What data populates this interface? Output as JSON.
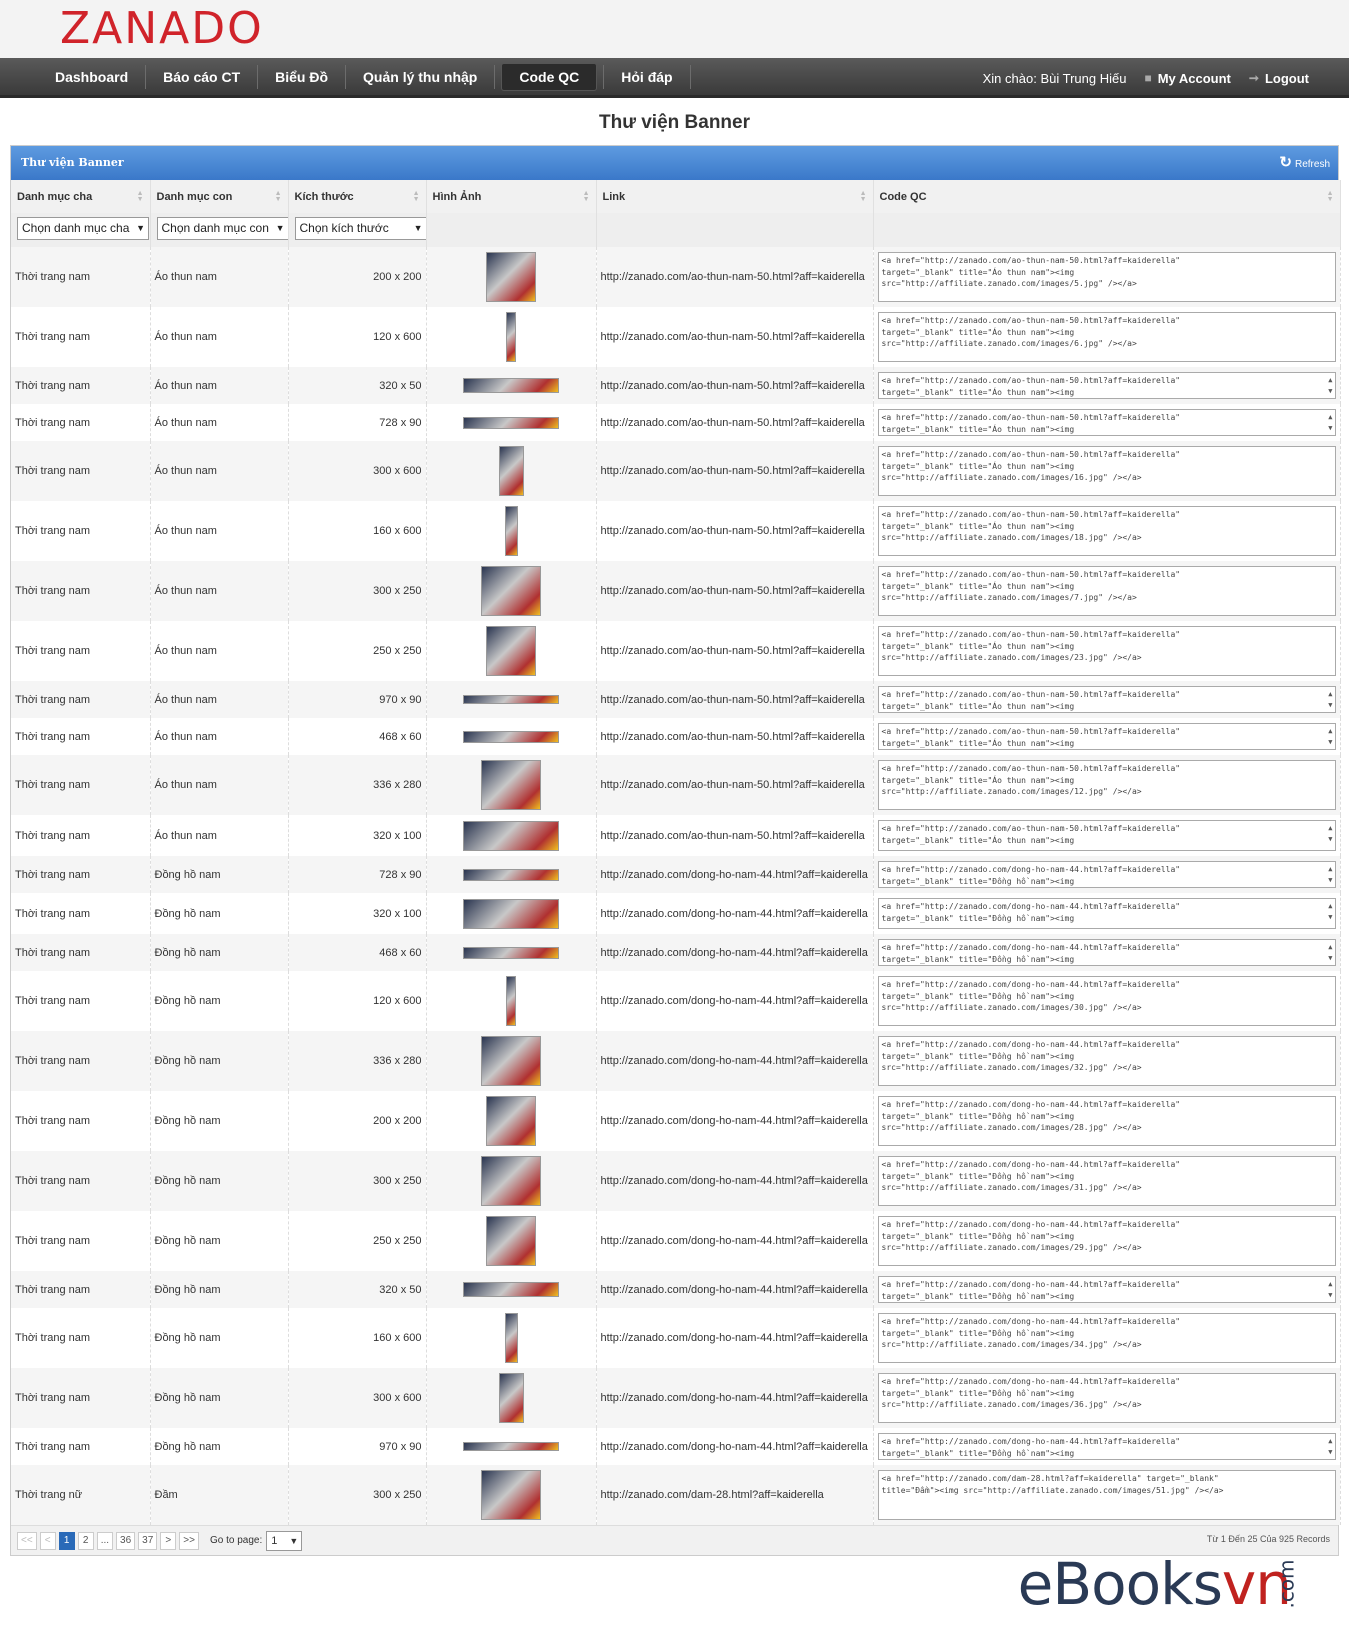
{
  "brand": {
    "logo": "ZANADO"
  },
  "nav": {
    "items": [
      "Dashboard",
      "Báo cáo CT",
      "Biểu Đồ",
      "Quản lý thu nhập",
      "Code QC",
      "Hỏi đáp"
    ],
    "active": "Code QC",
    "greeting": "Xin chào: Bùi Trung Hiếu",
    "account": "My Account",
    "logout": "Logout"
  },
  "page": {
    "title": "Thư viện Banner"
  },
  "panel": {
    "title": "Thư viện Banner",
    "refresh": "Refresh"
  },
  "table": {
    "headers": [
      "Danh mục cha",
      "Danh mục con",
      "Kích thước",
      "Hình Ảnh",
      "Link",
      "Code QC"
    ],
    "filters": [
      "Chọn danh mục cha",
      "Chọn danh mục con",
      "Chọn kích thước"
    ],
    "rows": [
      {
        "parent": "Thời trang nam",
        "child": "Áo thun nam",
        "size": "200 x 200",
        "link": "http://zanado.com/ao-thun-nam-50.html?aff=kaiderella",
        "code": "<a href=\"http://zanado.com/ao-thun-nam-50.html?aff=kaiderella\"\ntarget=\"_blank\" title=\"Áo thun nam\"><img\nsrc=\"http://affiliate.zanado.com/images/5.jpg\" /></a>"
      },
      {
        "parent": "Thời trang nam",
        "child": "Áo thun nam",
        "size": "120 x 600",
        "link": "http://zanado.com/ao-thun-nam-50.html?aff=kaiderella",
        "code": "<a href=\"http://zanado.com/ao-thun-nam-50.html?aff=kaiderella\"\ntarget=\"_blank\" title=\"Áo thun nam\"><img\nsrc=\"http://affiliate.zanado.com/images/6.jpg\" /></a>"
      },
      {
        "parent": "Thời trang nam",
        "child": "Áo thun nam",
        "size": "320 x 50",
        "link": "http://zanado.com/ao-thun-nam-50.html?aff=kaiderella",
        "code": "<a href=\"http://zanado.com/ao-thun-nam-50.html?aff=kaiderella\"\ntarget=\"_blank\" title=\"Áo thun nam\"><img"
      },
      {
        "parent": "Thời trang nam",
        "child": "Áo thun nam",
        "size": "728 x 90",
        "link": "http://zanado.com/ao-thun-nam-50.html?aff=kaiderella",
        "code": "<a href=\"http://zanado.com/ao-thun-nam-50.html?aff=kaiderella\"\ntarget=\"_blank\" title=\"Áo thun nam\"><img"
      },
      {
        "parent": "Thời trang nam",
        "child": "Áo thun nam",
        "size": "300 x 600",
        "link": "http://zanado.com/ao-thun-nam-50.html?aff=kaiderella",
        "code": "<a href=\"http://zanado.com/ao-thun-nam-50.html?aff=kaiderella\"\ntarget=\"_blank\" title=\"Áo thun nam\"><img\nsrc=\"http://affiliate.zanado.com/images/16.jpg\" /></a>"
      },
      {
        "parent": "Thời trang nam",
        "child": "Áo thun nam",
        "size": "160 x 600",
        "link": "http://zanado.com/ao-thun-nam-50.html?aff=kaiderella",
        "code": "<a href=\"http://zanado.com/ao-thun-nam-50.html?aff=kaiderella\"\ntarget=\"_blank\" title=\"Áo thun nam\"><img\nsrc=\"http://affiliate.zanado.com/images/18.jpg\" /></a>"
      },
      {
        "parent": "Thời trang nam",
        "child": "Áo thun nam",
        "size": "300 x 250",
        "link": "http://zanado.com/ao-thun-nam-50.html?aff=kaiderella",
        "code": "<a href=\"http://zanado.com/ao-thun-nam-50.html?aff=kaiderella\"\ntarget=\"_blank\" title=\"Áo thun nam\"><img\nsrc=\"http://affiliate.zanado.com/images/7.jpg\" /></a>"
      },
      {
        "parent": "Thời trang nam",
        "child": "Áo thun nam",
        "size": "250 x 250",
        "link": "http://zanado.com/ao-thun-nam-50.html?aff=kaiderella",
        "code": "<a href=\"http://zanado.com/ao-thun-nam-50.html?aff=kaiderella\"\ntarget=\"_blank\" title=\"Áo thun nam\"><img\nsrc=\"http://affiliate.zanado.com/images/23.jpg\" /></a>"
      },
      {
        "parent": "Thời trang nam",
        "child": "Áo thun nam",
        "size": "970 x 90",
        "link": "http://zanado.com/ao-thun-nam-50.html?aff=kaiderella",
        "code": "<a href=\"http://zanado.com/ao-thun-nam-50.html?aff=kaiderella\"\ntarget=\"_blank\" title=\"Áo thun nam\"><img"
      },
      {
        "parent": "Thời trang nam",
        "child": "Áo thun nam",
        "size": "468 x 60",
        "link": "http://zanado.com/ao-thun-nam-50.html?aff=kaiderella",
        "code": "<a href=\"http://zanado.com/ao-thun-nam-50.html?aff=kaiderella\"\ntarget=\"_blank\" title=\"Áo thun nam\"><img"
      },
      {
        "parent": "Thời trang nam",
        "child": "Áo thun nam",
        "size": "336 x 280",
        "link": "http://zanado.com/ao-thun-nam-50.html?aff=kaiderella",
        "code": "<a href=\"http://zanado.com/ao-thun-nam-50.html?aff=kaiderella\"\ntarget=\"_blank\" title=\"Áo thun nam\"><img\nsrc=\"http://affiliate.zanado.com/images/12.jpg\" /></a>"
      },
      {
        "parent": "Thời trang nam",
        "child": "Áo thun nam",
        "size": "320 x 100",
        "link": "http://zanado.com/ao-thun-nam-50.html?aff=kaiderella",
        "code": "<a href=\"http://zanado.com/ao-thun-nam-50.html?aff=kaiderella\"\ntarget=\"_blank\" title=\"Áo thun nam\"><img"
      },
      {
        "parent": "Thời trang nam",
        "child": "Đồng hồ nam",
        "size": "728 x 90",
        "link": "http://zanado.com/dong-ho-nam-44.html?aff=kaiderella",
        "code": "<a href=\"http://zanado.com/dong-ho-nam-44.html?aff=kaiderella\"\ntarget=\"_blank\" title=\"Đồng hồ nam\"><img"
      },
      {
        "parent": "Thời trang nam",
        "child": "Đồng hồ nam",
        "size": "320 x 100",
        "link": "http://zanado.com/dong-ho-nam-44.html?aff=kaiderella",
        "code": "<a href=\"http://zanado.com/dong-ho-nam-44.html?aff=kaiderella\"\ntarget=\"_blank\" title=\"Đồng hồ nam\"><img"
      },
      {
        "parent": "Thời trang nam",
        "child": "Đồng hồ nam",
        "size": "468 x 60",
        "link": "http://zanado.com/dong-ho-nam-44.html?aff=kaiderella",
        "code": "<a href=\"http://zanado.com/dong-ho-nam-44.html?aff=kaiderella\"\ntarget=\"_blank\" title=\"Đồng hồ nam\"><img"
      },
      {
        "parent": "Thời trang nam",
        "child": "Đồng hồ nam",
        "size": "120 x 600",
        "link": "http://zanado.com/dong-ho-nam-44.html?aff=kaiderella",
        "code": "<a href=\"http://zanado.com/dong-ho-nam-44.html?aff=kaiderella\"\ntarget=\"_blank\" title=\"Đồng hồ nam\"><img\nsrc=\"http://affiliate.zanado.com/images/30.jpg\" /></a>"
      },
      {
        "parent": "Thời trang nam",
        "child": "Đồng hồ nam",
        "size": "336 x 280",
        "link": "http://zanado.com/dong-ho-nam-44.html?aff=kaiderella",
        "code": "<a href=\"http://zanado.com/dong-ho-nam-44.html?aff=kaiderella\"\ntarget=\"_blank\" title=\"Đồng hồ nam\"><img\nsrc=\"http://affiliate.zanado.com/images/32.jpg\" /></a>"
      },
      {
        "parent": "Thời trang nam",
        "child": "Đồng hồ nam",
        "size": "200 x 200",
        "link": "http://zanado.com/dong-ho-nam-44.html?aff=kaiderella",
        "code": "<a href=\"http://zanado.com/dong-ho-nam-44.html?aff=kaiderella\"\ntarget=\"_blank\" title=\"Đồng hồ nam\"><img\nsrc=\"http://affiliate.zanado.com/images/28.jpg\" /></a>"
      },
      {
        "parent": "Thời trang nam",
        "child": "Đồng hồ nam",
        "size": "300 x 250",
        "link": "http://zanado.com/dong-ho-nam-44.html?aff=kaiderella",
        "code": "<a href=\"http://zanado.com/dong-ho-nam-44.html?aff=kaiderella\"\ntarget=\"_blank\" title=\"Đồng hồ nam\"><img\nsrc=\"http://affiliate.zanado.com/images/31.jpg\" /></a>"
      },
      {
        "parent": "Thời trang nam",
        "child": "Đồng hồ nam",
        "size": "250 x 250",
        "link": "http://zanado.com/dong-ho-nam-44.html?aff=kaiderella",
        "code": "<a href=\"http://zanado.com/dong-ho-nam-44.html?aff=kaiderella\"\ntarget=\"_blank\" title=\"Đồng hồ nam\"><img\nsrc=\"http://affiliate.zanado.com/images/29.jpg\" /></a>"
      },
      {
        "parent": "Thời trang nam",
        "child": "Đồng hồ nam",
        "size": "320 x 50",
        "link": "http://zanado.com/dong-ho-nam-44.html?aff=kaiderella",
        "code": "<a href=\"http://zanado.com/dong-ho-nam-44.html?aff=kaiderella\"\ntarget=\"_blank\" title=\"Đồng hồ nam\"><img"
      },
      {
        "parent": "Thời trang nam",
        "child": "Đồng hồ nam",
        "size": "160 x 600",
        "link": "http://zanado.com/dong-ho-nam-44.html?aff=kaiderella",
        "code": "<a href=\"http://zanado.com/dong-ho-nam-44.html?aff=kaiderella\"\ntarget=\"_blank\" title=\"Đồng hồ nam\"><img\nsrc=\"http://affiliate.zanado.com/images/34.jpg\" /></a>"
      },
      {
        "parent": "Thời trang nam",
        "child": "Đồng hồ nam",
        "size": "300 x 600",
        "link": "http://zanado.com/dong-ho-nam-44.html?aff=kaiderella",
        "code": "<a href=\"http://zanado.com/dong-ho-nam-44.html?aff=kaiderella\"\ntarget=\"_blank\" title=\"Đồng hồ nam\"><img\nsrc=\"http://affiliate.zanado.com/images/36.jpg\" /></a>"
      },
      {
        "parent": "Thời trang nam",
        "child": "Đồng hồ nam",
        "size": "970 x 90",
        "link": "http://zanado.com/dong-ho-nam-44.html?aff=kaiderella",
        "code": "<a href=\"http://zanado.com/dong-ho-nam-44.html?aff=kaiderella\"\ntarget=\"_blank\" title=\"Đồng hồ nam\"><img"
      },
      {
        "parent": "Thời trang nữ",
        "child": "Đầm",
        "size": "300 x 250",
        "link": "http://zanado.com/dam-28.html?aff=kaiderella",
        "code": "<a href=\"http://zanado.com/dam-28.html?aff=kaiderella\" target=\"_blank\"\ntitle=\"Đầm\"><img src=\"http://affiliate.zanado.com/images/51.jpg\" /></a>"
      }
    ]
  },
  "pager": {
    "buttons": [
      "<<",
      "<",
      "1",
      "2",
      "...",
      "36",
      "37",
      ">",
      ">>"
    ],
    "current": "1",
    "goto_label": "Go to page:",
    "goto_value": "1",
    "records": "Từ 1 Đến 25 Của 925 Records"
  },
  "watermark": {
    "text": "eBooks",
    "accent": "vn",
    "suffix": ".com"
  }
}
